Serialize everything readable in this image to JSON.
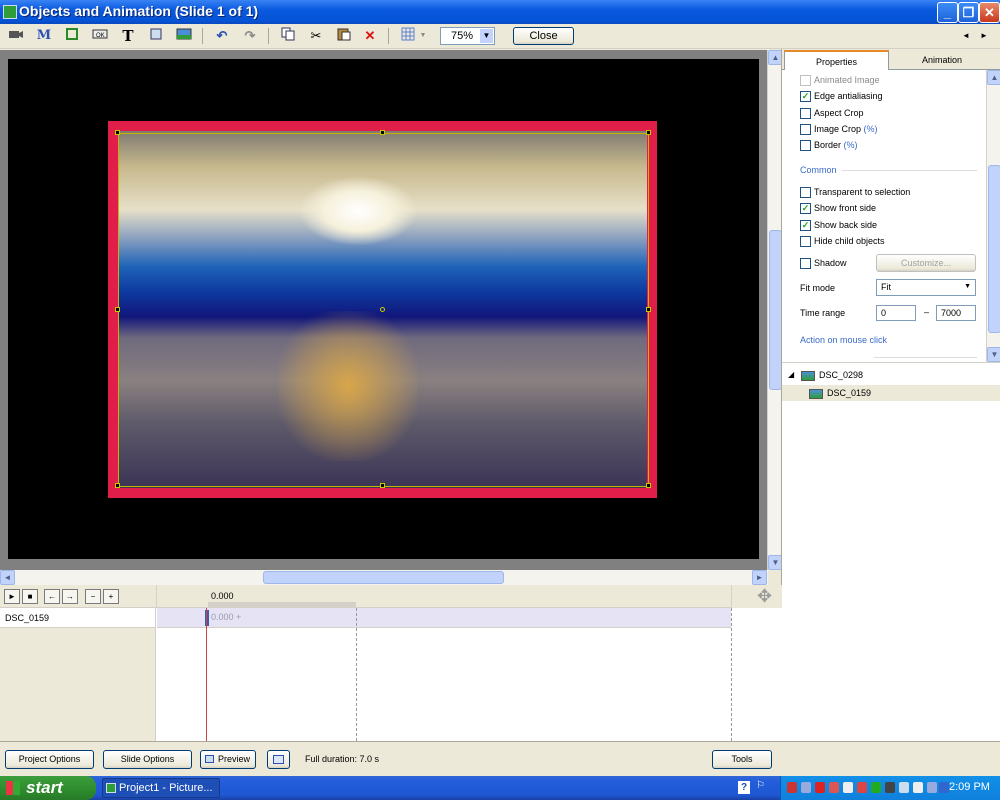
{
  "window": {
    "title": "Objects and Animation (Slide 1 of 1)"
  },
  "titlebar": {
    "minimize": "_",
    "maximize": "❐",
    "close": "✕"
  },
  "toolbar": {
    "icons": [
      "camera-icon",
      "m-icon",
      "frame-icon",
      "ok-button-icon",
      "text-icon",
      "rectangle-icon",
      "image-icon",
      "undo-icon",
      "redo-icon",
      "copy-icon",
      "cut-icon",
      "paste-icon",
      "delete-icon",
      "grid-icon",
      "grid-dropdown-icon"
    ],
    "zoom_value": "75%",
    "close_label": "Close",
    "nav_prev": "◄",
    "nav_next": "►"
  },
  "properties": {
    "tabs": [
      "Properties",
      "Animation"
    ],
    "items": [
      {
        "label": "Animated Image",
        "checked": false,
        "disabled": true,
        "pct": ""
      },
      {
        "label": "Edge antialiasing",
        "checked": true,
        "disabled": false,
        "pct": ""
      },
      {
        "label": "Aspect Crop",
        "checked": false,
        "disabled": false,
        "pct": ""
      },
      {
        "label": "Image Crop",
        "checked": false,
        "disabled": false,
        "pct": "(%)"
      },
      {
        "label": "Border",
        "checked": false,
        "disabled": false,
        "pct": "(%)"
      }
    ],
    "common_title": "Common",
    "common_items": [
      {
        "label": "Transparent to selection",
        "checked": false
      },
      {
        "label": "Show front side",
        "checked": true
      },
      {
        "label": "Show back side",
        "checked": true
      },
      {
        "label": "Hide child objects",
        "checked": false
      }
    ],
    "shadow_label": "Shadow",
    "shadow_checked": false,
    "customize_label": "Customize...",
    "fit_mode_label": "Fit mode",
    "fit_mode_value": "Fit",
    "time_range_label": "Time range",
    "time_from": "0",
    "time_dash": "–",
    "time_to": "7000",
    "action_title": "Action on mouse click"
  },
  "tree": {
    "nodes": [
      {
        "label": "DSC_0298",
        "level": 0
      },
      {
        "label": "DSC_0159",
        "level": 1
      }
    ]
  },
  "timeline": {
    "buttons": [
      "►",
      "■",
      "←",
      "→",
      "−",
      "+"
    ],
    "time_marker": "0.000",
    "track_name": "DSC_0159",
    "track_value": "0.000 +"
  },
  "bottombar": {
    "project_options": "Project Options",
    "slide_options": "Slide Options",
    "preview": "Preview",
    "full_duration": "Full duration: 7.0 s",
    "tools": "Tools"
  },
  "taskbar": {
    "start_label": "start",
    "task_label": "Project1 - Picture...",
    "clock": "2:09 PM"
  }
}
